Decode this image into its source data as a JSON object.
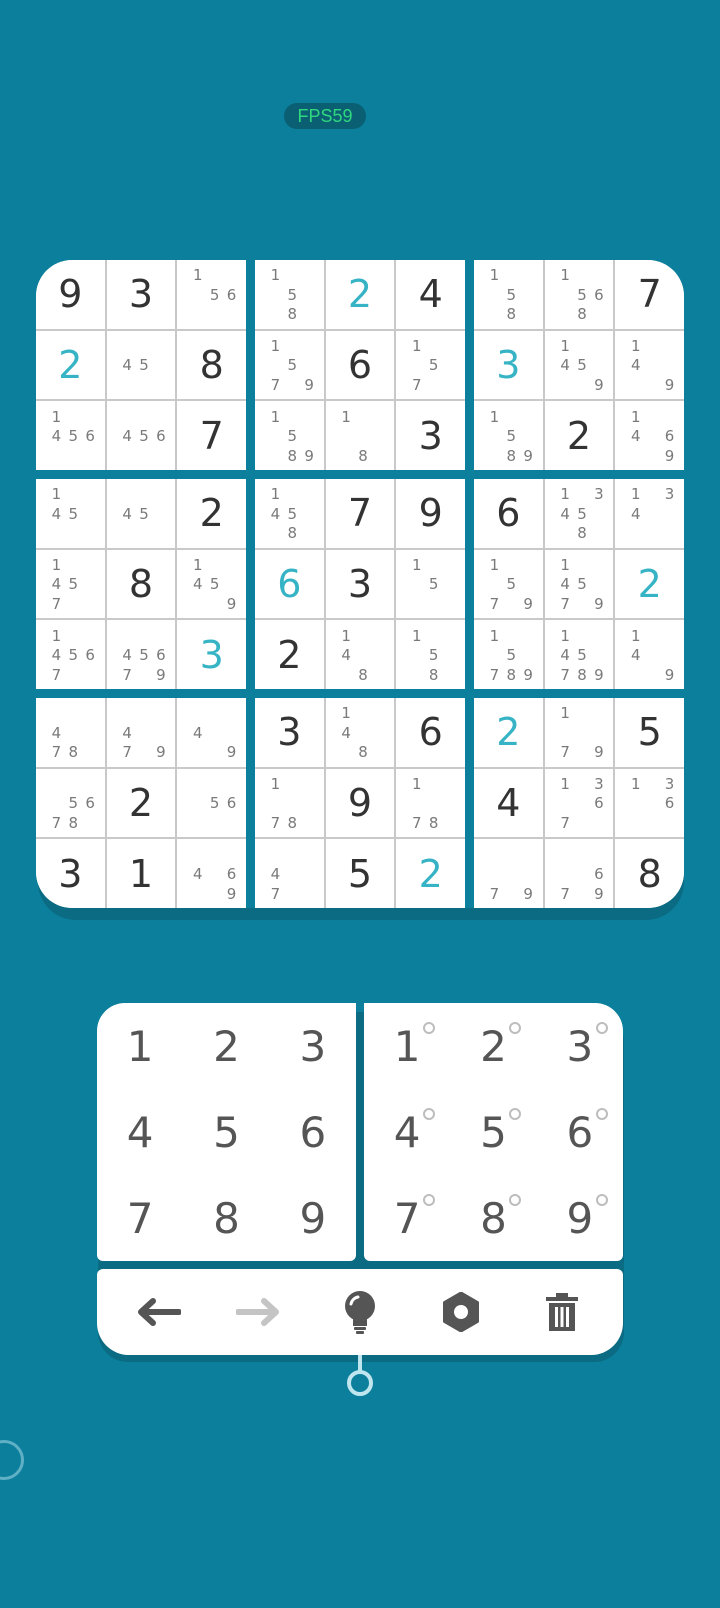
{
  "fps": {
    "label": "FPS59"
  },
  "board": {
    "cells": [
      [
        {
          "v": "9",
          "t": "given"
        },
        {
          "v": "3",
          "t": "given"
        },
        {
          "n": [
            "1",
            "",
            "",
            "",
            "5",
            "6",
            "",
            "",
            ""
          ]
        },
        {
          "n": [
            "1",
            "",
            "",
            "",
            "5",
            "",
            "",
            "8",
            ""
          ]
        },
        {
          "v": "2",
          "t": "user"
        },
        {
          "v": "4",
          "t": "given"
        },
        {
          "n": [
            "1",
            "",
            "",
            "",
            "5",
            "",
            "",
            "8",
            ""
          ]
        },
        {
          "n": [
            "1",
            "",
            "",
            "",
            "5",
            "6",
            "",
            "8",
            ""
          ]
        },
        {
          "v": "7",
          "t": "given"
        }
      ],
      [
        {
          "v": "2",
          "t": "user"
        },
        {
          "n": [
            "",
            "",
            "",
            "4",
            "5",
            "",
            "",
            "",
            ""
          ]
        },
        {
          "v": "8",
          "t": "given"
        },
        {
          "n": [
            "1",
            "",
            "",
            "",
            "5",
            "",
            "7",
            "",
            "9"
          ]
        },
        {
          "v": "6",
          "t": "given"
        },
        {
          "n": [
            "1",
            "",
            "",
            "",
            "5",
            "",
            "7",
            "",
            ""
          ]
        },
        {
          "v": "3",
          "t": "user"
        },
        {
          "n": [
            "1",
            "",
            "",
            "4",
            "5",
            "",
            "",
            "",
            "9"
          ]
        },
        {
          "n": [
            "1",
            "",
            "",
            "4",
            "",
            "",
            "",
            "",
            "9"
          ]
        }
      ],
      [
        {
          "n": [
            "1",
            "",
            "",
            "4",
            "5",
            "6",
            "",
            "",
            ""
          ]
        },
        {
          "n": [
            "",
            "",
            "",
            "4",
            "5",
            "6",
            "",
            "",
            ""
          ]
        },
        {
          "v": "7",
          "t": "given"
        },
        {
          "n": [
            "1",
            "",
            "",
            "",
            "5",
            "",
            "",
            "8",
            "9"
          ]
        },
        {
          "n": [
            "1",
            "",
            "",
            "",
            "",
            "",
            "",
            "8",
            ""
          ]
        },
        {
          "v": "3",
          "t": "given"
        },
        {
          "n": [
            "1",
            "",
            "",
            "",
            "5",
            "",
            "",
            "8",
            "9"
          ]
        },
        {
          "v": "2",
          "t": "given"
        },
        {
          "n": [
            "1",
            "",
            "",
            "4",
            "",
            "6",
            "",
            "",
            "9"
          ]
        }
      ],
      [
        {
          "n": [
            "1",
            "",
            "",
            "4",
            "5",
            "",
            "",
            "",
            ""
          ]
        },
        {
          "n": [
            "",
            "",
            "",
            "4",
            "5",
            "",
            "",
            "",
            ""
          ]
        },
        {
          "v": "2",
          "t": "given"
        },
        {
          "n": [
            "1",
            "",
            "",
            "4",
            "5",
            "",
            "",
            "8",
            ""
          ]
        },
        {
          "v": "7",
          "t": "given"
        },
        {
          "v": "9",
          "t": "given"
        },
        {
          "v": "6",
          "t": "given"
        },
        {
          "n": [
            "1",
            "",
            "3",
            "4",
            "5",
            "",
            "",
            "8",
            ""
          ]
        },
        {
          "n": [
            "1",
            "",
            "3",
            "4",
            "",
            "",
            "",
            "",
            ""
          ]
        }
      ],
      [
        {
          "n": [
            "1",
            "",
            "",
            "4",
            "5",
            "",
            "7",
            "",
            ""
          ]
        },
        {
          "v": "8",
          "t": "given"
        },
        {
          "n": [
            "1",
            "",
            "",
            "4",
            "5",
            "",
            "",
            "",
            "9"
          ]
        },
        {
          "v": "6",
          "t": "user"
        },
        {
          "v": "3",
          "t": "given"
        },
        {
          "n": [
            "1",
            "",
            "",
            "",
            "5",
            "",
            "",
            "",
            ""
          ]
        },
        {
          "n": [
            "1",
            "",
            "",
            "",
            "5",
            "",
            "7",
            "",
            "9"
          ]
        },
        {
          "n": [
            "1",
            "",
            "",
            "4",
            "5",
            "",
            "7",
            "",
            "9"
          ]
        },
        {
          "v": "2",
          "t": "user"
        }
      ],
      [
        {
          "n": [
            "1",
            "",
            "",
            "4",
            "5",
            "6",
            "7",
            "",
            ""
          ]
        },
        {
          "n": [
            "",
            "",
            "",
            "4",
            "5",
            "6",
            "7",
            "",
            "9"
          ]
        },
        {
          "v": "3",
          "t": "user"
        },
        {
          "v": "2",
          "t": "given"
        },
        {
          "n": [
            "1",
            "",
            "",
            "4",
            "",
            "",
            "",
            "8",
            ""
          ]
        },
        {
          "n": [
            "1",
            "",
            "",
            "",
            "5",
            "",
            "",
            "8",
            ""
          ]
        },
        {
          "n": [
            "1",
            "",
            "",
            "",
            "5",
            "",
            "7",
            "8",
            "9"
          ]
        },
        {
          "n": [
            "1",
            "",
            "",
            "4",
            "5",
            "",
            "7",
            "8",
            "9"
          ]
        },
        {
          "n": [
            "1",
            "",
            "",
            "4",
            "",
            "",
            "",
            "",
            "9"
          ]
        }
      ],
      [
        {
          "n": [
            "",
            "",
            "",
            "4",
            "",
            "",
            "7",
            "8",
            ""
          ]
        },
        {
          "n": [
            "",
            "",
            "",
            "4",
            "",
            "",
            "7",
            "",
            "9"
          ]
        },
        {
          "n": [
            "",
            "",
            "",
            "4",
            "",
            "",
            "",
            "",
            "9"
          ]
        },
        {
          "v": "3",
          "t": "given"
        },
        {
          "n": [
            "1",
            "",
            "",
            "4",
            "",
            "",
            "",
            "8",
            ""
          ]
        },
        {
          "v": "6",
          "t": "given"
        },
        {
          "v": "2",
          "t": "user"
        },
        {
          "n": [
            "1",
            "",
            "",
            "",
            "",
            "",
            "7",
            "",
            "9"
          ]
        },
        {
          "v": "5",
          "t": "given"
        }
      ],
      [
        {
          "n": [
            "",
            "",
            "",
            "",
            "5",
            "6",
            "7",
            "8",
            ""
          ]
        },
        {
          "v": "2",
          "t": "given"
        },
        {
          "n": [
            "",
            "",
            "",
            "",
            "5",
            "6",
            "",
            "",
            ""
          ]
        },
        {
          "n": [
            "1",
            "",
            "",
            "",
            "",
            "",
            "7",
            "8",
            ""
          ]
        },
        {
          "v": "9",
          "t": "given"
        },
        {
          "n": [
            "1",
            "",
            "",
            "",
            "",
            "",
            "7",
            "8",
            ""
          ]
        },
        {
          "v": "4",
          "t": "given"
        },
        {
          "n": [
            "1",
            "",
            "3",
            "",
            "",
            "6",
            "7",
            "",
            ""
          ]
        },
        {
          "n": [
            "1",
            "",
            "3",
            "",
            "",
            "6",
            "",
            "",
            ""
          ]
        }
      ],
      [
        {
          "v": "3",
          "t": "given"
        },
        {
          "v": "1",
          "t": "given"
        },
        {
          "n": [
            "",
            "",
            "",
            "4",
            "",
            "6",
            "",
            "",
            "9"
          ]
        },
        {
          "n": [
            "",
            "",
            "",
            "4",
            "",
            "",
            "7",
            "",
            ""
          ]
        },
        {
          "v": "5",
          "t": "given"
        },
        {
          "v": "2",
          "t": "user"
        },
        {
          "n": [
            "",
            "",
            "",
            "",
            "",
            "",
            "7",
            "",
            "9"
          ]
        },
        {
          "n": [
            "",
            "",
            "",
            "",
            "",
            "6",
            "7",
            "",
            "9"
          ]
        },
        {
          "v": "8",
          "t": "given"
        }
      ]
    ]
  },
  "keypad": {
    "numbers": [
      "1",
      "2",
      "3",
      "4",
      "5",
      "6",
      "7",
      "8",
      "9"
    ],
    "notes": [
      "1",
      "2",
      "3",
      "4",
      "5",
      "6",
      "7",
      "8",
      "9"
    ]
  },
  "toolbar": {
    "undo_icon": "arrow-left-icon",
    "redo_icon": "arrow-right-icon",
    "hint_icon": "lightbulb-icon",
    "settings_icon": "gear-icon",
    "delete_icon": "trash-icon"
  },
  "colors": {
    "background": "#0b7f9b",
    "user_digit": "#36b3c4",
    "given_digit": "#333333"
  }
}
